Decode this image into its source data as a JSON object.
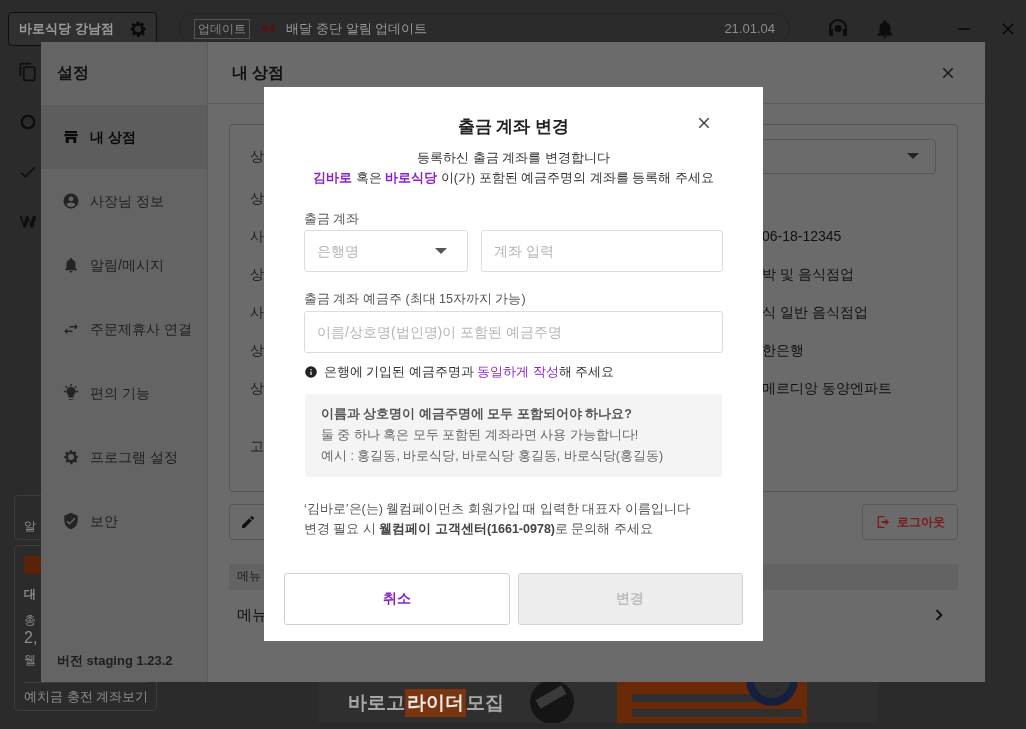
{
  "app": {
    "store_name": "바로식당 강남점",
    "notice": {
      "tag": "업데이트",
      "text": "배달 중단 알림 업데이트",
      "date": "21.01.04"
    },
    "side_card": {
      "fragment": "알"
    },
    "wallet": {
      "title": "대",
      "line": "총",
      "amount": "2,",
      "footer": "웰",
      "button": "예치금 충전 계좌보기"
    },
    "banner": {
      "parts": [
        {
          "text": "바로고",
          "highlight": false
        },
        {
          "text": "라이더",
          "highlight": true
        },
        {
          "text": "모집",
          "highlight": false
        }
      ]
    }
  },
  "settings": {
    "title": "설정",
    "menu": [
      {
        "label": "내 상점",
        "selected": true
      },
      {
        "label": "사장님 정보",
        "selected": false
      },
      {
        "label": "알림/메시지",
        "selected": false
      },
      {
        "label": "주문제휴사 연결",
        "selected": false
      },
      {
        "label": "편의 기능",
        "selected": false
      },
      {
        "label": "프로그램 설정",
        "selected": false
      },
      {
        "label": "보안",
        "selected": false
      }
    ],
    "version": "버전 staging 1.23.2",
    "page_title": "내 상점",
    "rows": [
      {
        "label": "상",
        "kind": "select"
      },
      {
        "label": "상",
        "kind": "empty"
      },
      {
        "label": "사",
        "kind": "text",
        "value": "06-18-12345"
      },
      {
        "label": "상",
        "kind": "text",
        "value": "박 및 음식점업"
      },
      {
        "label": "사",
        "kind": "text",
        "value": "식 일반 음식점업"
      },
      {
        "label": "상",
        "kind": "text",
        "value": "한은행"
      },
      {
        "label": "상",
        "kind": "text",
        "value": "메르디앙 동양엔파트"
      },
      {
        "label": "고",
        "kind": "empty"
      }
    ],
    "logout": "로그아웃",
    "menu_table": {
      "header": "메뉴",
      "row_title": "메뉴"
    }
  },
  "dialog": {
    "title": "출금 계좌 변경",
    "intro": "등록하신 출금 계좌를 변경합니다",
    "instruction": "**김바로** 혹은 **바로식당** 이(가) 포함된 예금주명의 계좌를 등록해 주세요",
    "account_label": "출금 계좌",
    "bank_select": {
      "placeholder": "은행명"
    },
    "account_input": {
      "placeholder": "계좌 입력"
    },
    "holder_label": "출금 계좌 예금주 (최대 15자까지 가능)",
    "holder_input": {
      "placeholder": "이름/상호명(법인명)이 포함된 예금주명"
    },
    "hint": [
      {
        "text": "은행에 기입된 예금주명과 ",
        "highlight": false
      },
      {
        "text": "동일하게 작성",
        "highlight": true
      },
      {
        "text": "해 주세요",
        "highlight": false
      }
    ],
    "faq": {
      "question": "이름과 상호명이 예금주명에 모두 포함되어야 하나요?",
      "answer": "둘 중 하나 혹은 모두 포함된 계좌라면 사용 가능합니다!",
      "example": "예시 : 홍길동,  바로식당, 바로식당 홍길동,  바로식당(홍길동)"
    },
    "notes": [
      "‘김바로’은(는) 웰컴페이먼츠 회원가입 때 입력한 대표자 이름입니다",
      "변경 필요 시 **웰컴페이 고객센터(1661-0978)**로 문의해 주세요"
    ],
    "buttons": [
      {
        "label": "취소",
        "disabled": false
      },
      {
        "label": "변경",
        "disabled": true
      }
    ]
  }
}
